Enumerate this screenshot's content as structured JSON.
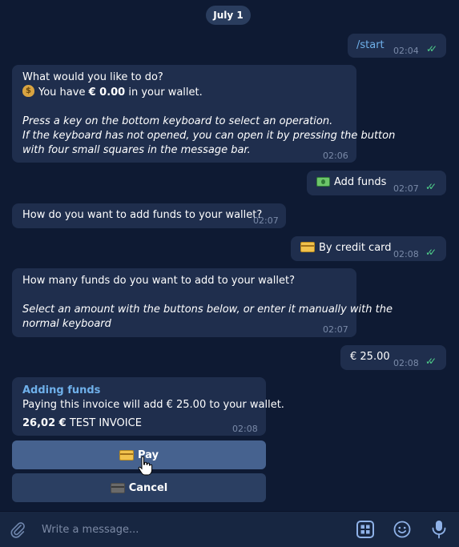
{
  "date_label": "July 1",
  "messages": {
    "start": {
      "text": "/start",
      "time": "02:04"
    },
    "menu": {
      "line1": "What would you like to do?",
      "line2_prefix": "You have ",
      "line2_amount": "€ 0.00",
      "line2_suffix": " in your wallet.",
      "line3": "Press a key on the bottom keyboard to select an operation.",
      "line4": "If the keyboard has not opened, you can open it by pressing the button",
      "line5": "with four small squares in the message bar.",
      "time": "02:06"
    },
    "add_funds": {
      "text": "Add funds",
      "time": "02:07"
    },
    "how_add": {
      "text": "How do you want to add funds to your wallet?",
      "time": "02:07"
    },
    "by_card": {
      "text": "By credit card",
      "time": "02:08"
    },
    "how_many": {
      "line1": "How many funds do you want to add to your wallet?",
      "line2": "Select an amount with the buttons below, or enter it manually with the",
      "line3": "normal keyboard",
      "time": "02:07"
    },
    "amount": {
      "text": "€ 25.00",
      "time": "02:08"
    },
    "invoice": {
      "title": "Adding funds",
      "description": "Paying this invoice will add € 25.00 to your wallet.",
      "price": "26,02 €",
      "label": "TEST INVOICE",
      "time": "02:08"
    }
  },
  "keyboard": {
    "pay_label": "Pay",
    "cancel_label": "Cancel"
  },
  "composer": {
    "placeholder": "Write a message..."
  },
  "colors": {
    "background": "#0e1a33",
    "bubble": "#1f2e4d",
    "accent": "#6fb0ea",
    "read_ticks": "#4fd08a",
    "pay_button": "#46628f"
  },
  "icons": {
    "attach": "paperclip-icon",
    "keyboard": "keyboard-grid-icon",
    "emoji": "smile-icon",
    "voice": "microphone-icon"
  }
}
